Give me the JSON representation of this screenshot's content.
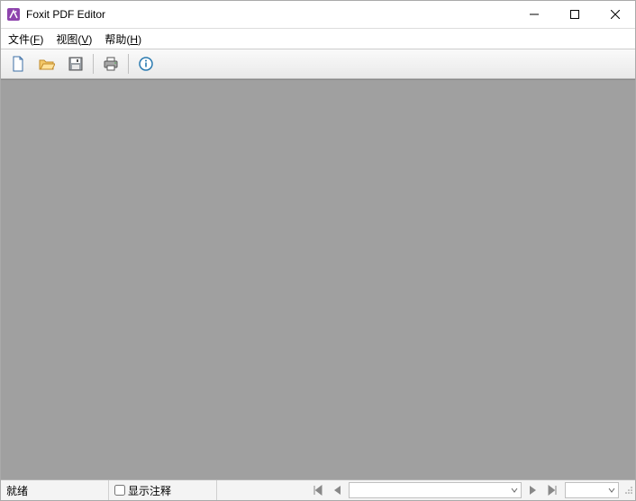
{
  "titlebar": {
    "app_name": "Foxit PDF Editor"
  },
  "menubar": {
    "file": {
      "label": "文件",
      "key": "F"
    },
    "view": {
      "label": "视图",
      "key": "V"
    },
    "help": {
      "label": "帮助",
      "key": "H"
    }
  },
  "statusbar": {
    "ready": "就绪",
    "show_annotations": "显示注释"
  }
}
